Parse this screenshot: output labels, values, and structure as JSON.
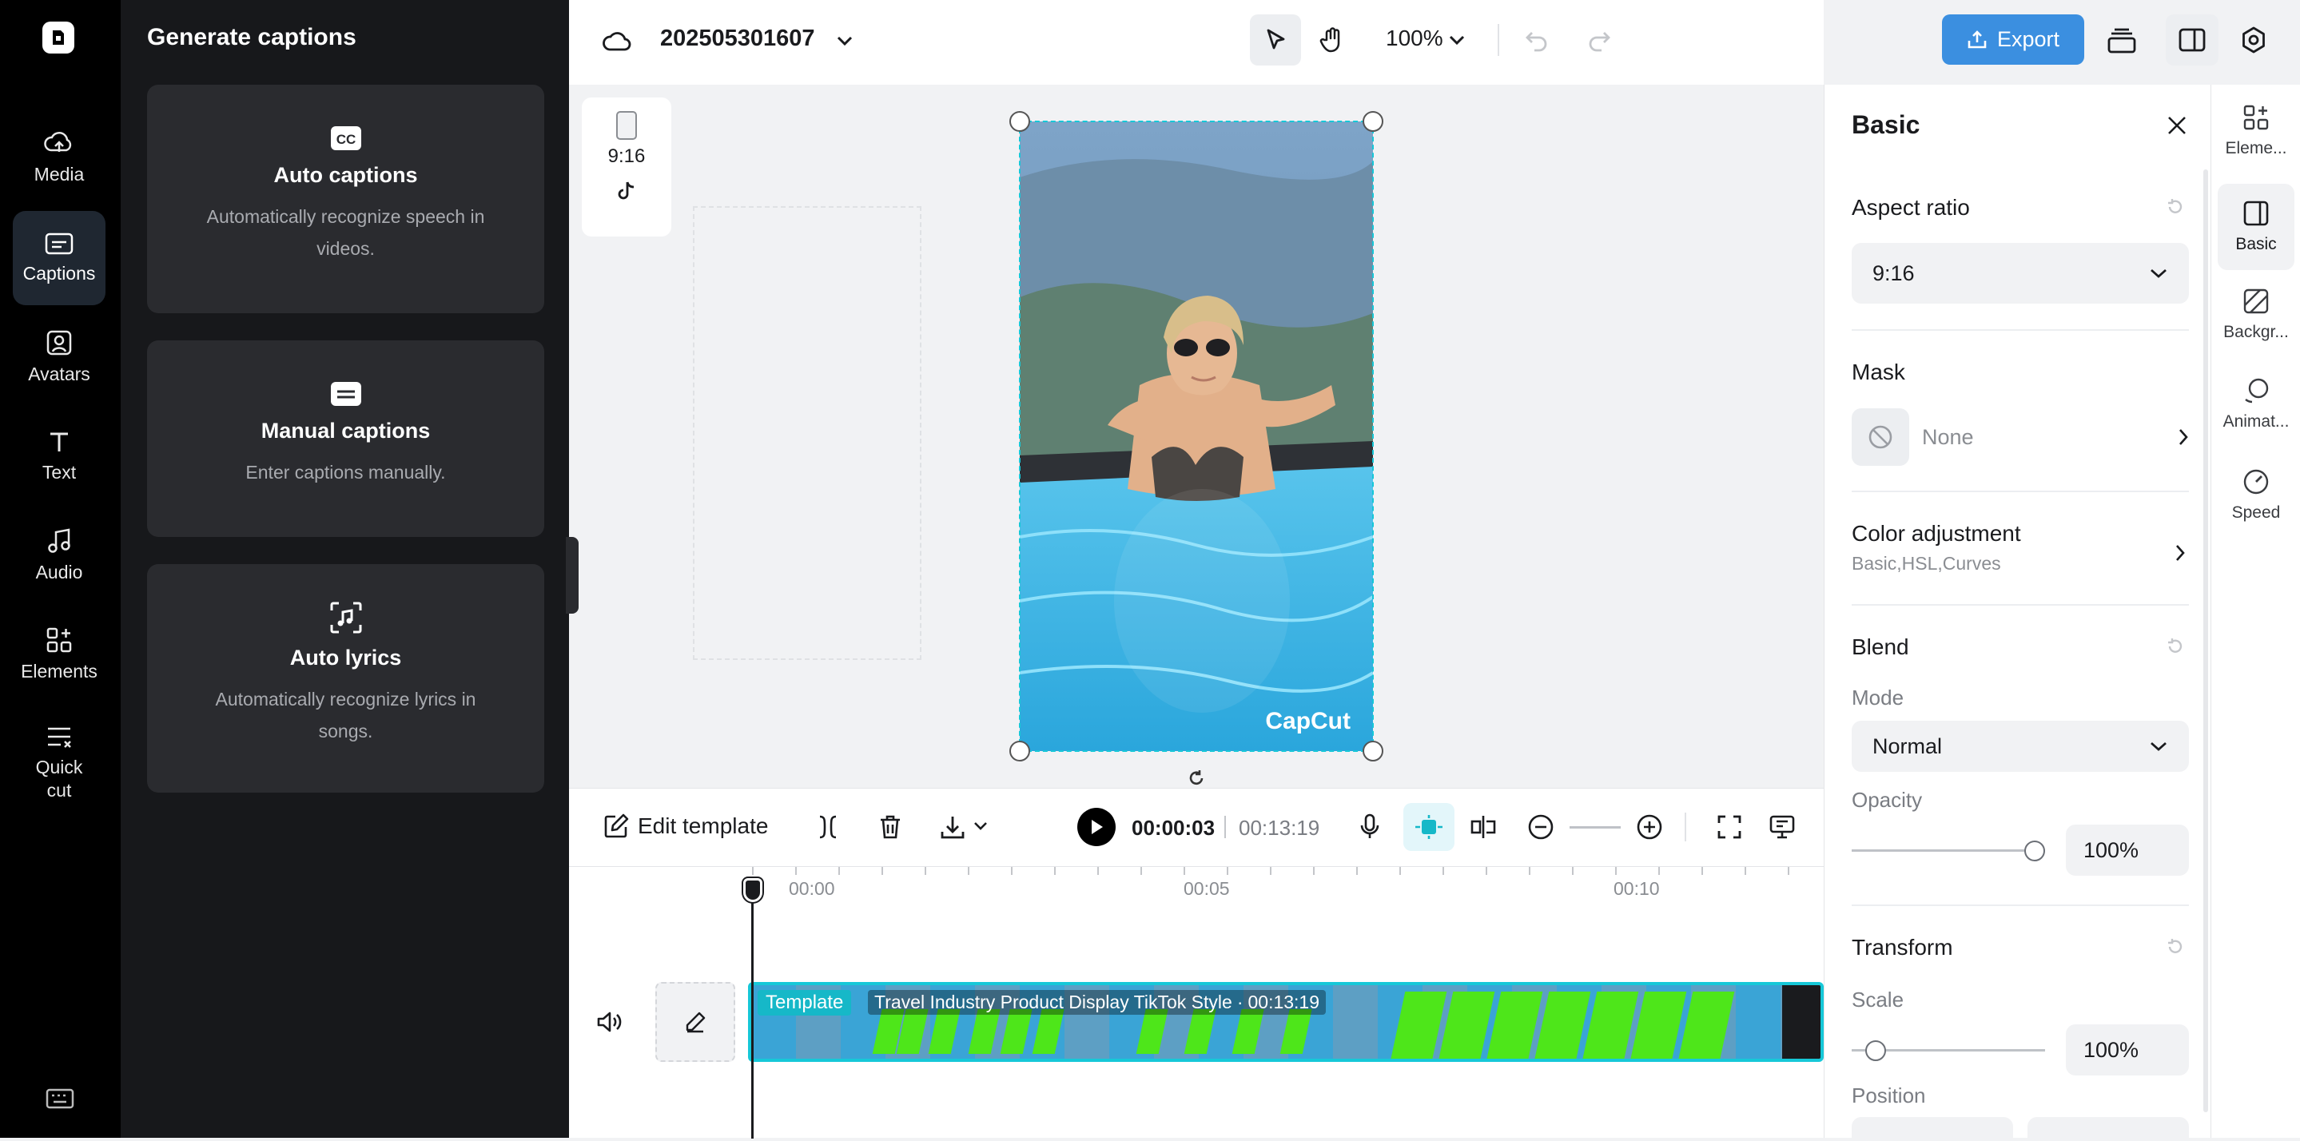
{
  "project": {
    "title": "202505301607",
    "zoom": "100%",
    "export_label": "Export"
  },
  "rail": {
    "items": [
      {
        "label": "Media"
      },
      {
        "label": "Captions"
      },
      {
        "label": "Avatars"
      },
      {
        "label": "Text"
      },
      {
        "label": "Audio"
      },
      {
        "label": "Elements"
      },
      {
        "label": "Quick cut"
      }
    ]
  },
  "panel": {
    "title": "Generate captions",
    "cards": [
      {
        "title": "Auto captions",
        "desc": "Automatically recognize speech in videos."
      },
      {
        "title": "Manual captions",
        "desc": "Enter captions manually."
      },
      {
        "title": "Auto lyrics",
        "desc": "Automatically recognize lyrics in songs."
      }
    ]
  },
  "canvas": {
    "ratio_label": "9:16",
    "watermark": "CapCut"
  },
  "toolbar": {
    "edit_template": "Edit template",
    "current_time": "00:00:03",
    "total_time": "00:13:19"
  },
  "timeline": {
    "ticks": [
      "00:00",
      "00:05",
      "00:10"
    ],
    "clip_badge": "Template",
    "clip_title": "Travel Industry Product Display TikTok Style",
    "clip_duration": "00:13:19"
  },
  "props": {
    "title": "Basic",
    "aspect_ratio": {
      "label": "Aspect ratio",
      "value": "9:16"
    },
    "mask": {
      "label": "Mask",
      "value": "None"
    },
    "color_adjustment": {
      "label": "Color adjustment",
      "sub": "Basic,HSL,Curves"
    },
    "blend": {
      "label": "Blend",
      "mode_label": "Mode",
      "mode_value": "Normal",
      "opacity_label": "Opacity",
      "opacity_value": "100%",
      "opacity_level": 1.0
    },
    "transform": {
      "label": "Transform",
      "scale_label": "Scale",
      "scale_value": "100%",
      "scale_level": 0.08,
      "position_label": "Position"
    }
  },
  "tabs": [
    {
      "label": "Eleme..."
    },
    {
      "label": "Basic"
    },
    {
      "label": "Backgr..."
    },
    {
      "label": "Animat..."
    },
    {
      "label": "Speed"
    }
  ],
  "colors": {
    "accent": "#3b8fe0",
    "selection": "#16c8d8",
    "clip_green": "#4ee61a"
  }
}
